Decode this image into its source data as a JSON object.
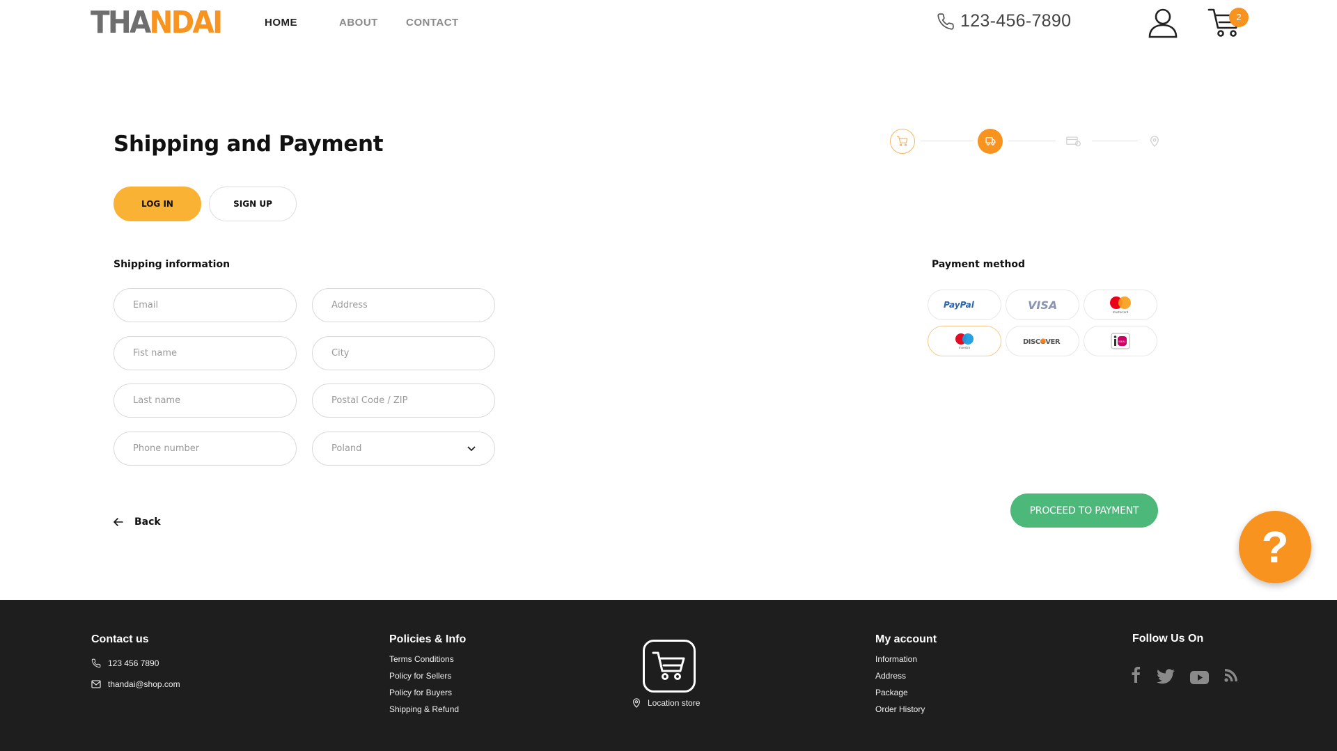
{
  "header": {
    "logo_part1": "THA",
    "logo_part2": "NDAI",
    "nav": {
      "home": "HOME",
      "about": "ABOUT",
      "contact": "CONTACT"
    },
    "phone": "123-456-7890",
    "cart_count": "2",
    "accent_color": "#f7931e"
  },
  "main": {
    "title": "Shipping and Payment",
    "login_label": "LOG IN",
    "signup_label": "SIGN UP",
    "shipping_title": "Shipping information",
    "payment_title": "Payment method",
    "fields": {
      "email_placeholder": "Email",
      "first_name_placeholder": "Fist name",
      "last_name_placeholder": "Last name",
      "phone_placeholder": "Phone number",
      "address_placeholder": "Address",
      "city_placeholder": "City",
      "postal_placeholder": "Postal Code / ZIP",
      "country_value": "Poland"
    },
    "payment_methods": [
      "PayPal",
      "VISA",
      "mastercard",
      "maestro",
      "DISCOVER",
      "iDEAL"
    ],
    "selected_payment": "maestro",
    "back_label": "Back",
    "proceed_label": "PROCEED TO PAYMENT",
    "proceed_color": "#4cb87a",
    "help_label": "?"
  },
  "footer": {
    "contact_title": "Contact us",
    "contact_phone": "123 456 7890",
    "contact_email": "thandai@shop.com",
    "policies_title": "Policies & Info",
    "policies": [
      "Terms Conditions",
      "Policy for Sellers",
      "Policy for Buyers",
      "Shipping & Refund"
    ],
    "location_label": "Location store",
    "account_title": "My account",
    "account_links": [
      "Information",
      "Address",
      "Package",
      "Order History"
    ],
    "follow_title": "Follow Us On",
    "social_icons": [
      "facebook-icon",
      "twitter-icon",
      "youtube-icon",
      "rss-icon"
    ]
  }
}
